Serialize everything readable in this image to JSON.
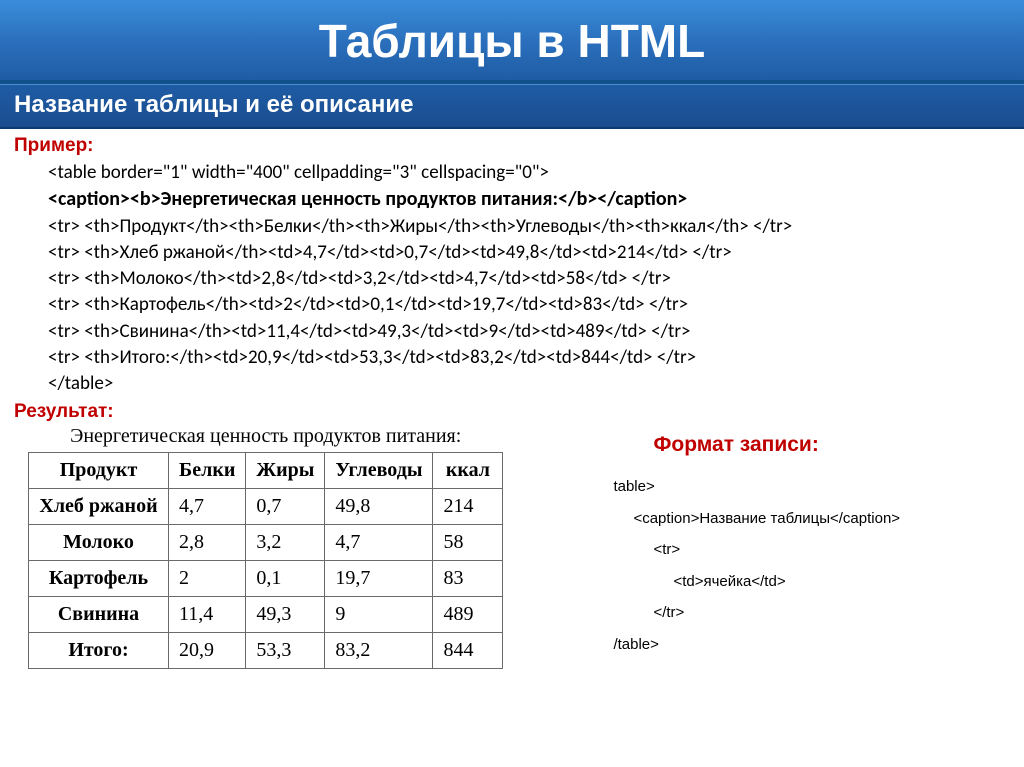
{
  "title": "Таблицы в HTML",
  "subtitle": "Название таблицы и её описание",
  "labels": {
    "example": "Пример:",
    "result": "Результат:",
    "format": "Формат записи:"
  },
  "code": {
    "line1": "<table border=\"1\" width=\"400\" cellpadding=\"3\" cellspacing=\"0\">",
    "caption": "<caption><b>Энергетическая ценность продуктов питания:</b></caption>",
    "row_h": "<tr> <th>Продукт</th><th>Белки</th><th>Жиры</th><th>Углеводы</th><th>ккал</th> </tr>",
    "row1": "<tr> <th>Хлеб ржаной</th><td>4,7</td><td>0,7</td><td>49,8</td><td>214</td> </tr>",
    "row2": "<tr> <th>Молоко</th><td>2,8</td><td>3,2</td><td>4,7</td><td>58</td> </tr>",
    "row3": "<tr> <th>Картофель</th><td>2</td><td>0,1</td><td>19,7</td><td>83</td> </tr>",
    "row4": "<tr> <th>Свинина</th><td>11,4</td><td>49,3</td><td>9</td><td>489</td> </tr>",
    "row5": "<tr> <th>Итого:</th><td>20,9</td><td>53,3</td><td>83,2</td><td>844</td> </tr>",
    "close": "</table>"
  },
  "result_caption": "Энергетическая ценность продуктов питания:",
  "table": {
    "headers": [
      "Продукт",
      "Белки",
      "Жиры",
      "Углеводы",
      "ккал"
    ],
    "rows": [
      [
        "Хлеб ржаной",
        "4,7",
        "0,7",
        "49,8",
        "214"
      ],
      [
        "Молоко",
        "2,8",
        "3,2",
        "4,7",
        "58"
      ],
      [
        "Картофель",
        "2",
        "0,1",
        "19,7",
        "83"
      ],
      [
        "Свинина",
        "11,4",
        "49,3",
        "9",
        "489"
      ],
      [
        "Итого:",
        "20,9",
        "53,3",
        "83,2",
        "844"
      ]
    ]
  },
  "format_code": {
    "l1": "table>",
    "l2": "<caption>Название таблицы</caption>",
    "l3": "<tr>",
    "l4": "<td>ячейка</td>",
    "l5": "</tr>",
    "l6": "/table>"
  }
}
